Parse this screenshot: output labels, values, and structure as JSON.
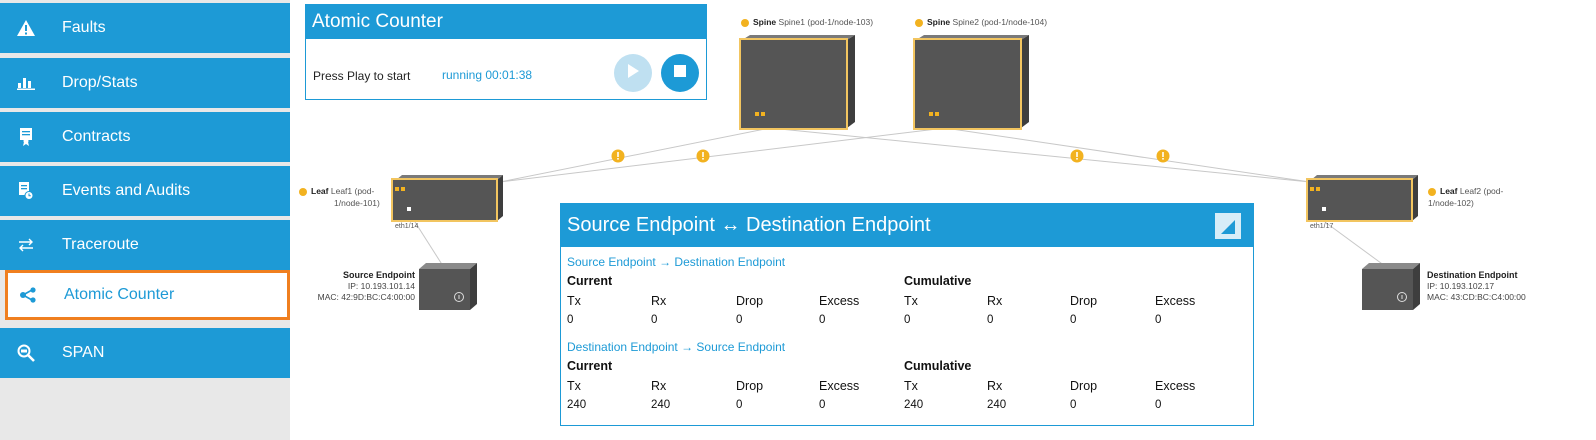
{
  "sidebar": {
    "items": [
      {
        "label": "Faults",
        "icon": "warning-icon",
        "active": false
      },
      {
        "label": "Drop/Stats",
        "icon": "bar-chart-icon",
        "active": false
      },
      {
        "label": "Contracts",
        "icon": "contract-icon",
        "active": false
      },
      {
        "label": "Events and Audits",
        "icon": "events-icon",
        "active": false
      },
      {
        "label": "Traceroute",
        "icon": "traceroute-icon",
        "active": false
      },
      {
        "label": "Atomic Counter",
        "icon": "share-nodes-icon",
        "active": true
      },
      {
        "label": "SPAN",
        "icon": "span-search-icon",
        "active": false
      }
    ]
  },
  "atomic_counter": {
    "title": "Atomic Counter",
    "prompt": "Press Play to start",
    "status": "running 00:01:38"
  },
  "topology": {
    "spines": [
      {
        "role": "Spine",
        "name": "Spine1 (pod-1/node-103)"
      },
      {
        "role": "Spine",
        "name": "Spine2 (pod-1/node-104)"
      }
    ],
    "leaves": [
      {
        "role": "Leaf",
        "name_line1": "Leaf1 (pod-",
        "name_line2": "1/node-101)",
        "port": "eth1/14"
      },
      {
        "role": "Leaf",
        "name_line1": "Leaf2 (pod-",
        "name_line2": "1/node-102)",
        "port": "eth1/17"
      }
    ],
    "source_endpoint": {
      "title": "Source Endpoint",
      "ip": "IP: 10.193.101.14",
      "mac": "MAC: 42:9D:BC:C4:00:00"
    },
    "destination_endpoint": {
      "title": "Destination Endpoint",
      "ip": "IP: 10.193.102.17",
      "mac": "MAC: 43:CD:BC:C4:00:00"
    }
  },
  "stats": {
    "title": "Source Endpoint ↔ Destination Endpoint",
    "sections": [
      {
        "title": "Source Endpoint → Destination Endpoint",
        "current_label": "Current",
        "cumulative_label": "Cumulative",
        "columns": [
          "Tx",
          "Rx",
          "Drop",
          "Excess"
        ],
        "current": [
          "0",
          "0",
          "0",
          "0"
        ],
        "cumulative": [
          "0",
          "0",
          "0",
          "0"
        ]
      },
      {
        "title": "Destination Endpoint → Source Endpoint",
        "current_label": "Current",
        "cumulative_label": "Cumulative",
        "columns": [
          "Tx",
          "Rx",
          "Drop",
          "Excess"
        ],
        "current": [
          "240",
          "240",
          "0",
          "0"
        ],
        "cumulative": [
          "240",
          "240",
          "0",
          "0"
        ]
      }
    ]
  },
  "colors": {
    "accent": "#1d9ad6",
    "active_border": "#f07f1f",
    "fault": "#f2b220",
    "device_body": "#555555"
  }
}
